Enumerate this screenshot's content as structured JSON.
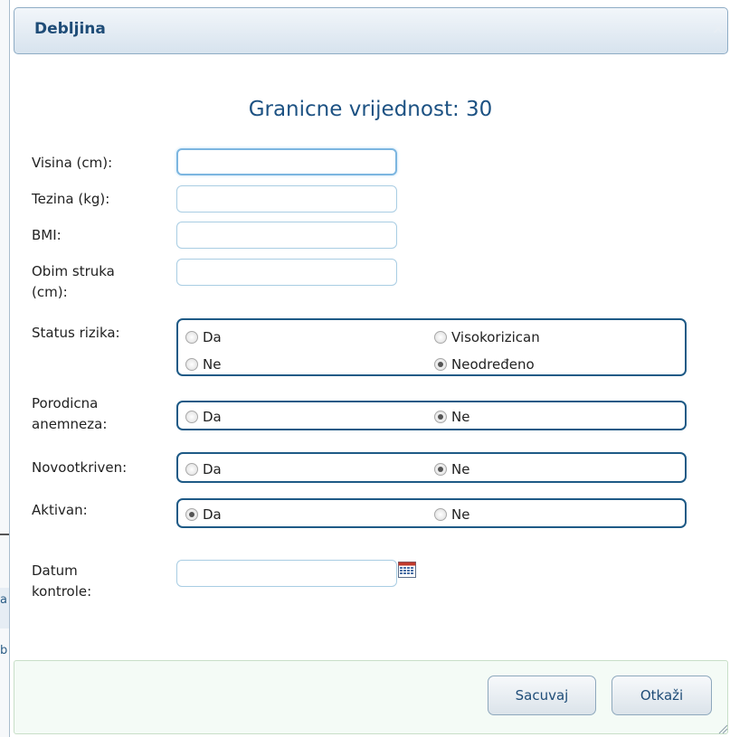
{
  "dialog": {
    "title": "Debljina",
    "close_symbol": "×"
  },
  "heading": "Granicne vrijednost: 30",
  "background_fragments": {
    "text_a": "a",
    "text_b": "b"
  },
  "fields": {
    "visina": {
      "label": "Visina (cm):",
      "value": ""
    },
    "tezina": {
      "label": "Tezina (kg):",
      "value": ""
    },
    "bmi": {
      "label": "BMI:",
      "value": ""
    },
    "obim": {
      "label_line1": "Obim struka",
      "label_line2": "(cm):",
      "value": ""
    },
    "datum": {
      "label_line1": "Datum",
      "label_line2": "kontrole:",
      "value": "",
      "icon": "calendar-icon"
    }
  },
  "status_rizika": {
    "label": "Status rizika:",
    "options": [
      {
        "label": "Da",
        "checked": false
      },
      {
        "label": "Ne",
        "checked": false
      },
      {
        "label": "Visokorizican",
        "checked": false
      },
      {
        "label": "Neodređeno",
        "checked": true
      }
    ]
  },
  "porodicna": {
    "label_line1": "Porodicna",
    "label_line2": "anemneza:",
    "options": [
      {
        "label": "Da",
        "checked": false
      },
      {
        "label": "Ne",
        "checked": true
      }
    ]
  },
  "novootkriven": {
    "label": "Novootkriven:",
    "options": [
      {
        "label": "Da",
        "checked": false
      },
      {
        "label": "Ne",
        "checked": true
      }
    ]
  },
  "aktivan": {
    "label": "Aktivan:",
    "options": [
      {
        "label": "Da",
        "checked": true
      },
      {
        "label": "Ne",
        "checked": false
      }
    ]
  },
  "buttons": {
    "save": "Sacuvaj",
    "cancel": "Otkaži"
  },
  "colors": {
    "accent": "#1d5283",
    "group_border": "#1e5a86",
    "input_border": "#a9cde3",
    "footer_bg": "#f4fbf6"
  }
}
